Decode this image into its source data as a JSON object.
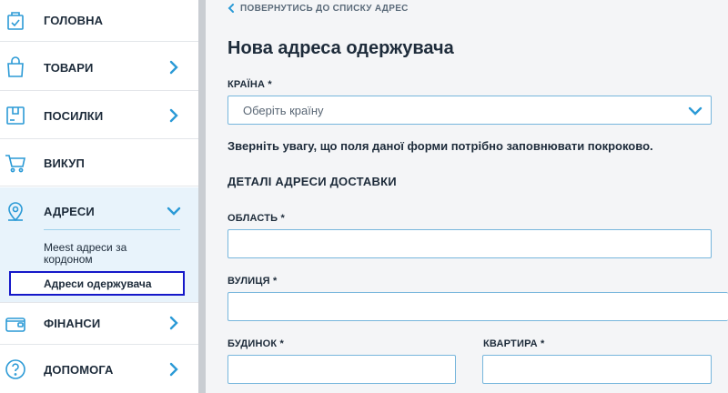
{
  "sidebar": {
    "items": [
      {
        "label": "ГОЛОВНА",
        "icon": "home-box-icon"
      },
      {
        "label": "ТОВАРИ",
        "icon": "shopping-bag-icon"
      },
      {
        "label": "ПОСИЛКИ",
        "icon": "parcel-icon"
      },
      {
        "label": "ВИКУП",
        "icon": "cart-icon"
      },
      {
        "label": "АДРЕСИ",
        "icon": "location-pin-icon"
      },
      {
        "label": "ФІНАНСИ",
        "icon": "wallet-icon"
      },
      {
        "label": "ДОПОМОГА",
        "icon": "help-icon"
      }
    ],
    "submenu": {
      "meest_line1": "Meest адреси за",
      "meest_line2": "кордоном",
      "selected": "Адреси одержувача"
    }
  },
  "main": {
    "back_link": "ПОВЕРНУТИСЬ ДО СПИСКУ АДРЕС",
    "title": "Нова адреса одержувача",
    "country_label": "КРАЇНА *",
    "country_placeholder": "Оберіть країну",
    "note": "Зверніть увагу, що поля даної форми потрібно заповнювати покроково.",
    "section_title": "ДЕТАЛІ АДРЕСИ ДОСТАВКИ",
    "region_label": "ОБЛАСТЬ *",
    "region_value": "",
    "street_label": "ВУЛИЦЯ *",
    "street_value": "",
    "house_label": "БУДИНОК *",
    "house_value": "",
    "apartment_label": "КВАРТИРА *",
    "apartment_value": ""
  },
  "colors": {
    "accent": "#2b9ad6",
    "border": "#77b6dc",
    "selected_outline": "#1518c9",
    "active_bg": "#e8f3fb"
  }
}
